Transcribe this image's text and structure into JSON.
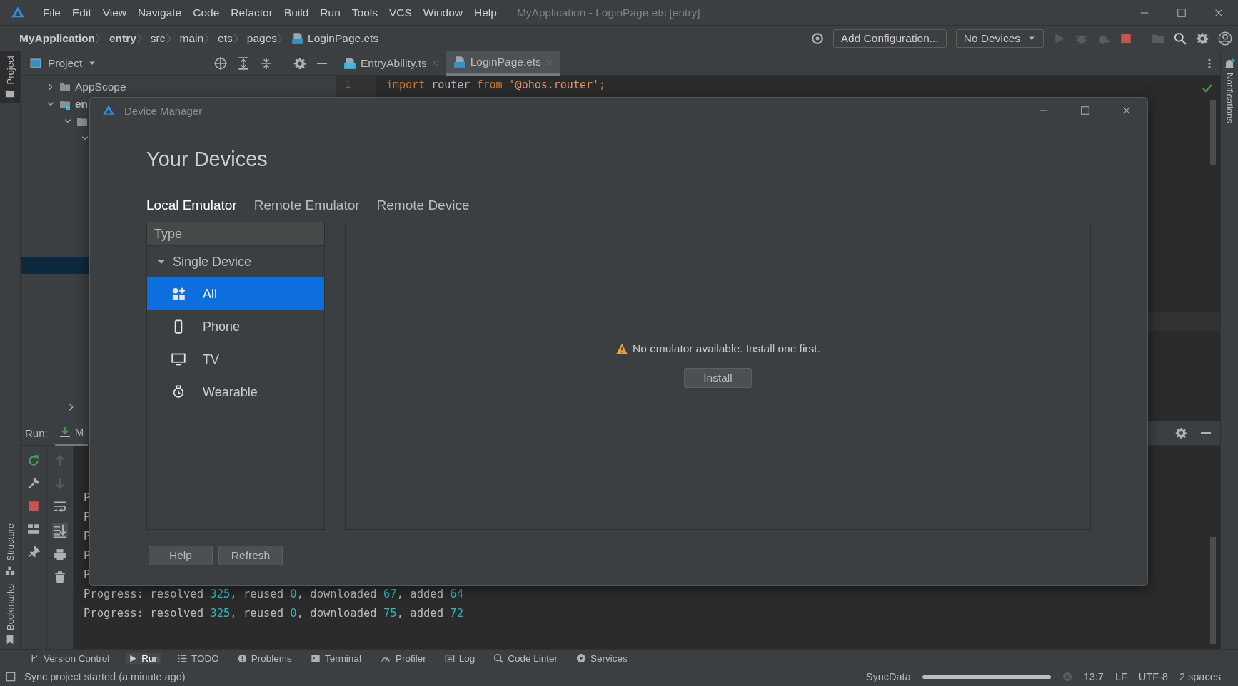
{
  "title_bar": {
    "menu": [
      "File",
      "Edit",
      "View",
      "Navigate",
      "Code",
      "Refactor",
      "Build",
      "Run",
      "Tools",
      "VCS",
      "Window",
      "Help"
    ],
    "title": "MyApplication - LoginPage.ets [entry]"
  },
  "nav_bar": {
    "breadcrumbs": [
      {
        "label": "MyApplication",
        "bold": true,
        "kind": "text"
      },
      {
        "label": "entry",
        "bold": true,
        "kind": "text"
      },
      {
        "label": "src",
        "bold": false,
        "kind": "text"
      },
      {
        "label": "main",
        "bold": false,
        "kind": "text"
      },
      {
        "label": "ets",
        "bold": false,
        "kind": "text"
      },
      {
        "label": "pages",
        "bold": false,
        "kind": "text"
      },
      {
        "label": "LoginPage.ets",
        "bold": false,
        "kind": "file"
      }
    ],
    "configuration": "Add Configuration...",
    "device_select": "No Devices"
  },
  "left_stripe": {
    "top": [
      {
        "label": "Project",
        "selected": true
      }
    ],
    "bottom": [
      {
        "label": "Structure",
        "selected": false
      },
      {
        "label": "Bookmarks",
        "selected": false
      }
    ]
  },
  "right_stripe": {
    "label": "Notifications"
  },
  "project_panel": {
    "title": "Project",
    "tree": [
      {
        "label": "AppScope",
        "kind": "folder",
        "expanded": false
      },
      {
        "label": "en",
        "kind": "module",
        "expanded": true,
        "children": [
          {
            "kind": "folder",
            "expanded": true,
            "children": [
              {
                "expanded": true
              }
            ]
          }
        ]
      }
    ]
  },
  "editor": {
    "tabs": [
      {
        "label": "EntryAbility.ts",
        "kind": "ts",
        "selected": false
      },
      {
        "label": "LoginPage.ets",
        "kind": "ets",
        "selected": true
      }
    ],
    "line_number": "1",
    "code": [
      {
        "text": "import",
        "kind": "keyword"
      },
      {
        "text": " router ",
        "kind": "plain"
      },
      {
        "text": "from",
        "kind": "keyword"
      },
      {
        "text": " '@ohos.router'",
        "kind": "string"
      },
      {
        "text": ";",
        "kind": "keyword"
      }
    ]
  },
  "run_panel": {
    "label": "Run:",
    "tab": "M",
    "console": [
      {
        "segments": [
          {
            "text": "P",
            "kind": "plain"
          }
        ]
      },
      {
        "segments": [
          {
            "text": "P",
            "kind": "plain"
          }
        ]
      },
      {
        "segments": [
          {
            "text": "P",
            "kind": "plain"
          }
        ]
      },
      {
        "segments": [
          {
            "text": "P",
            "kind": "plain"
          }
        ]
      },
      {
        "segments": [
          {
            "text": "P",
            "kind": "plain"
          }
        ]
      },
      {
        "segments": [
          {
            "text": "Progress: resolved ",
            "kind": "plain"
          },
          {
            "text": "325",
            "kind": "number"
          },
          {
            "text": ", reused ",
            "kind": "plain"
          },
          {
            "text": "0",
            "kind": "number"
          },
          {
            "text": ", downloaded ",
            "kind": "plain"
          },
          {
            "text": "67",
            "kind": "number"
          },
          {
            "text": ", added ",
            "kind": "plain"
          },
          {
            "text": "64",
            "kind": "number"
          }
        ]
      },
      {
        "segments": [
          {
            "text": "Progress: resolved ",
            "kind": "plain"
          },
          {
            "text": "325",
            "kind": "number"
          },
          {
            "text": ", reused ",
            "kind": "plain"
          },
          {
            "text": "0",
            "kind": "number"
          },
          {
            "text": ", downloaded ",
            "kind": "plain"
          },
          {
            "text": "75",
            "kind": "number"
          },
          {
            "text": ", added ",
            "kind": "plain"
          },
          {
            "text": "72",
            "kind": "number"
          }
        ]
      }
    ]
  },
  "device_manager": {
    "title": "Device Manager",
    "heading": "Your Devices",
    "tabs": [
      {
        "label": "Local Emulator",
        "selected": true
      },
      {
        "label": "Remote Emulator",
        "selected": false
      },
      {
        "label": "Remote Device",
        "selected": false
      }
    ],
    "type_header": "Type",
    "group": {
      "label": "Single Device",
      "expanded": true
    },
    "device_types": [
      {
        "label": "All",
        "kind": "all",
        "selected": true
      },
      {
        "label": "Phone",
        "kind": "phone",
        "selected": false
      },
      {
        "label": "TV",
        "kind": "tv",
        "selected": false
      },
      {
        "label": "Wearable",
        "kind": "watch",
        "selected": false
      }
    ],
    "message": "No emulator available. Install one first.",
    "install_button": "Install",
    "buttons": [
      "Help",
      "Refresh"
    ]
  },
  "tool_tabs": [
    {
      "label": "Version Control",
      "kind": "vcs",
      "selected": false
    },
    {
      "label": "Run",
      "kind": "run",
      "selected": true
    },
    {
      "label": "TODO",
      "kind": "todo",
      "selected": false
    },
    {
      "label": "Problems",
      "kind": "problems",
      "selected": false
    },
    {
      "label": "Terminal",
      "kind": "terminal",
      "selected": false
    },
    {
      "label": "Profiler",
      "kind": "profiler",
      "selected": false
    },
    {
      "label": "Log",
      "kind": "log",
      "selected": false
    },
    {
      "label": "Code Linter",
      "kind": "linter",
      "selected": false
    },
    {
      "label": "Services",
      "kind": "services",
      "selected": false
    }
  ],
  "status_bar": {
    "message": "Sync project started (a minute ago)",
    "task": "SyncData",
    "level": 1,
    "position": "13:7",
    "line_separator": "LF",
    "encoding": "UTF-8",
    "indent": "2 spaces"
  }
}
